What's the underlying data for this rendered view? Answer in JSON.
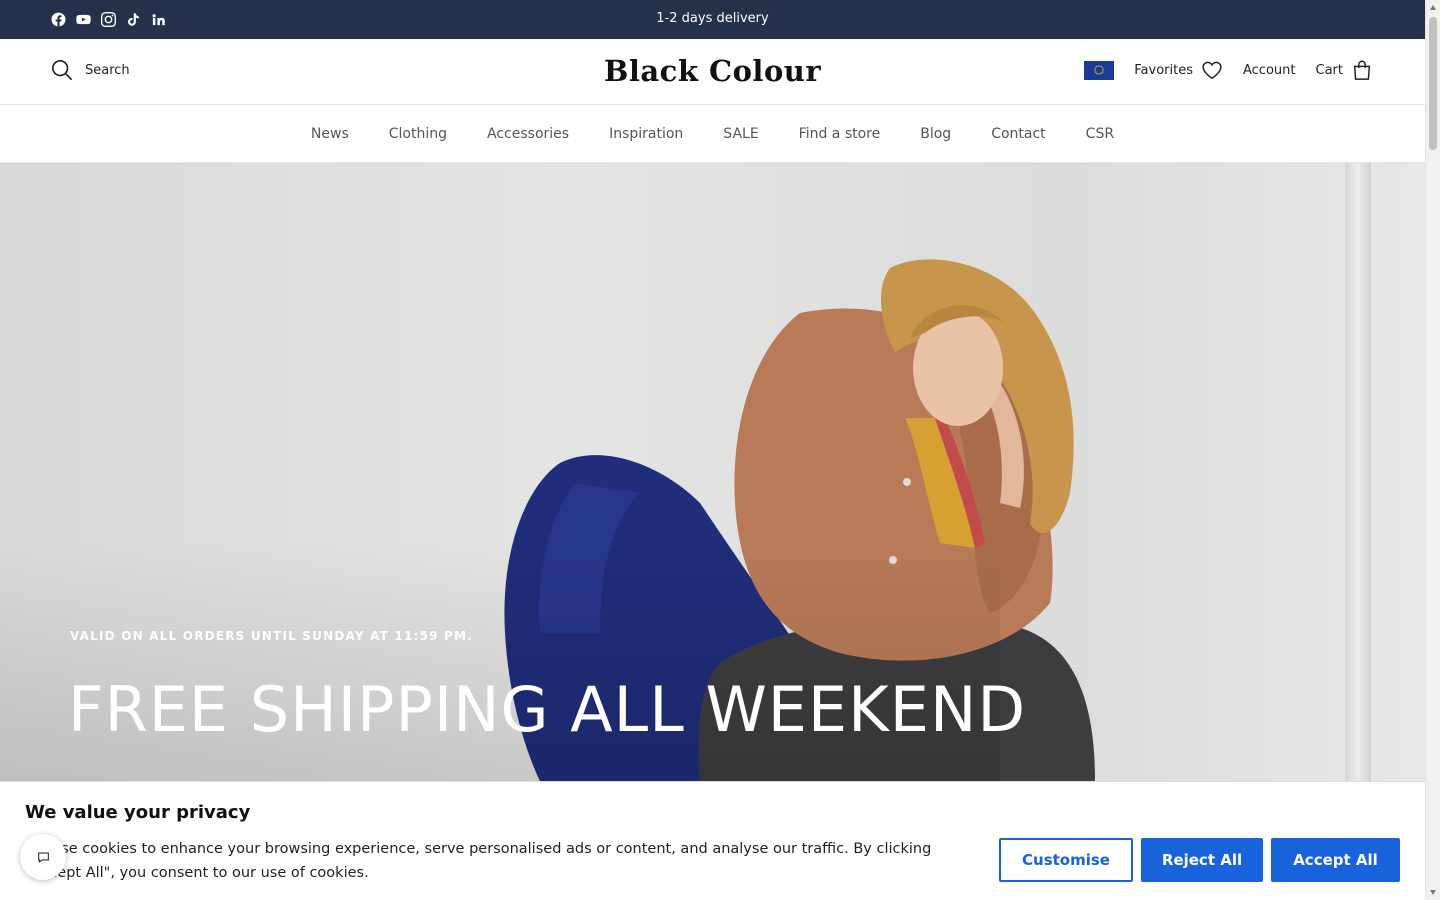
{
  "topbar": {
    "announcement": "1-2 days delivery",
    "social_icons": [
      "facebook-icon",
      "youtube-icon",
      "instagram-icon",
      "tiktok-icon",
      "linkedin-icon"
    ],
    "background_color": "#25304b"
  },
  "header": {
    "search_label": "Search",
    "logo": "Black Colour",
    "region_flag": "eu-flag-icon",
    "favorites_label": "Favorites",
    "account_label": "Account",
    "cart_label": "Cart"
  },
  "nav": {
    "items": [
      "News",
      "Clothing",
      "Accessories",
      "Inspiration",
      "SALE",
      "Find a store",
      "Blog",
      "Contact",
      "CSR"
    ]
  },
  "hero": {
    "subtitle": "VALID ON ALL ORDERS UNTIL SUNDAY AT 11:59 PM.",
    "title": "FREE SHIPPING ALL WEEKEND"
  },
  "cookie": {
    "title": "We value your privacy",
    "text": "We use cookies to enhance your browsing experience, serve personalised ads or content, and analyse our traffic. By clicking \"Accept All\", you consent to our use of cookies.",
    "customise_label": "Customise",
    "reject_label": "Reject All",
    "accept_label": "Accept All",
    "accent_color": "#1863dc"
  },
  "chat_widget": {
    "icon": "chat-bubble-icon"
  }
}
